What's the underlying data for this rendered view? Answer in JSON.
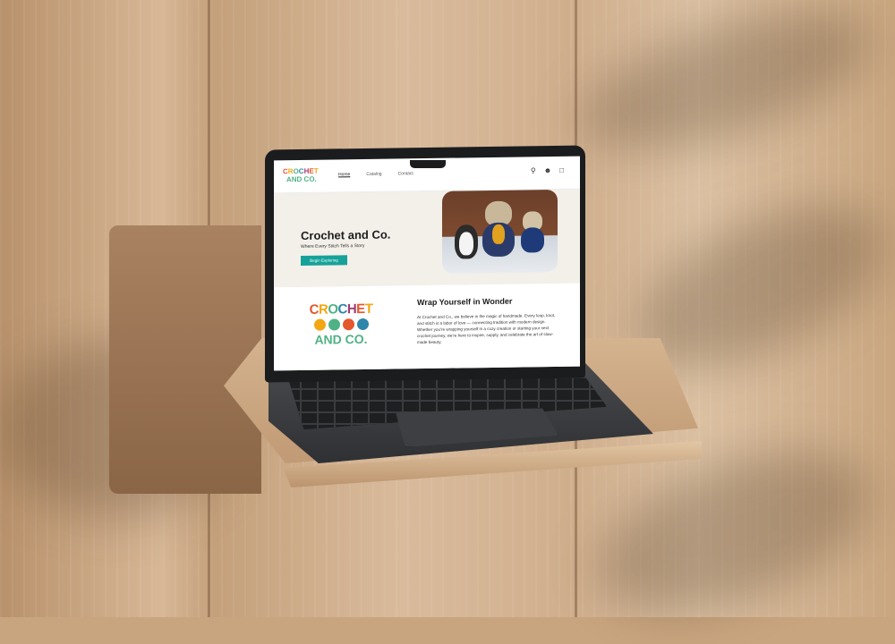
{
  "site": {
    "logo": {
      "line1": [
        "C",
        "R",
        "O",
        "C",
        "H",
        "E",
        "T"
      ],
      "line2": "AND CO."
    },
    "nav": [
      {
        "label": "Home",
        "active": true
      },
      {
        "label": "Catalog",
        "active": false
      },
      {
        "label": "Contact",
        "active": false
      }
    ],
    "icons": [
      "search-icon",
      "account-icon",
      "cart-icon"
    ],
    "hero": {
      "title": "Crochet and Co.",
      "subtitle": "Where Every Stitch Tells a Story",
      "button_label": "Begin Exploring"
    },
    "about": {
      "title": "Wrap Yourself in Wonder",
      "text": "At Crochet and Co., we believe in the magic of handmade. Every loop, knot, and stitch is a labor of love — connecting tradition with modern design. Whether you're wrapping yourself in a cozy creation or starting your next crochet journey, we're here to inspire, supply, and celebrate the art of slow-made beauty."
    }
  },
  "colors": {
    "accent": "#16a29a",
    "logo_orange": "#e4572e",
    "logo_yellow": "#f3a712",
    "logo_green": "#4fb286",
    "logo_blue": "#2e86ab",
    "logo_purple": "#a23b72"
  }
}
